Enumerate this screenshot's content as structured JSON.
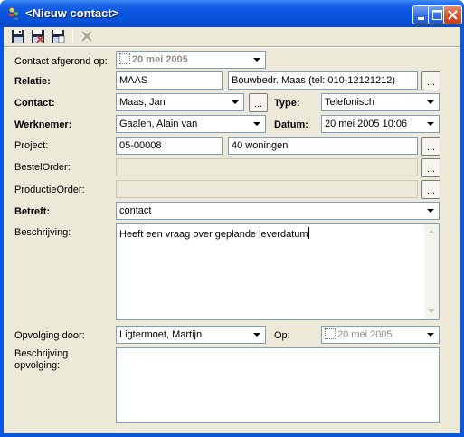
{
  "window": {
    "title": "<Nieuw contact>"
  },
  "icons": {
    "save": "save-icon",
    "save_close": "save-close-icon",
    "save_new": "save-new-icon",
    "delete": "delete-icon",
    "app": "contact-app-icon",
    "minimize": "minimize-icon",
    "maximize": "maximize-icon",
    "close": "close-icon"
  },
  "colors": {
    "titlebar": "#0a55e1",
    "background": "#ece9d8",
    "close_button": "#d5502f"
  },
  "form": {
    "contact_afgerond_label": "Contact afgerond op:",
    "contact_afgerond_value": "20 mei 2005",
    "relatie_label": "Relatie:",
    "relatie_code": "MAAS",
    "relatie_name": "Bouwbedr. Maas (tel: 010-12121212)",
    "contact_label": "Contact:",
    "contact_value": "Maas, Jan",
    "type_label": "Type:",
    "type_value": "Telefonisch",
    "werknemer_label": "Werknemer:",
    "werknemer_value": "Gaalen, Alain van",
    "datum_label": "Datum:",
    "datum_value": "20 mei 2005 10:06",
    "project_label": "Project:",
    "project_code": "05-00008",
    "project_name": "40 woningen",
    "bestelorder_label": "BestelOrder:",
    "bestelorder_value": "",
    "productieorder_label": "ProductieOrder:",
    "productieorder_value": "",
    "betreft_label": "Betreft:",
    "betreft_value": "contact",
    "beschrijving_label": "Beschrijving:",
    "beschrijving_value": "Heeft een vraag over geplande leverdatum",
    "opvolging_door_label": "Opvolging door:",
    "opvolging_door_value": "Ligtermoet, Martijn",
    "op_label": "Op:",
    "op_value": "20 mei 2005",
    "beschrijving_opvolging_label_1": "Beschrijving",
    "beschrijving_opvolging_label_2": "opvolging:",
    "beschrijving_opvolging_value": "",
    "browse_label": "..."
  }
}
